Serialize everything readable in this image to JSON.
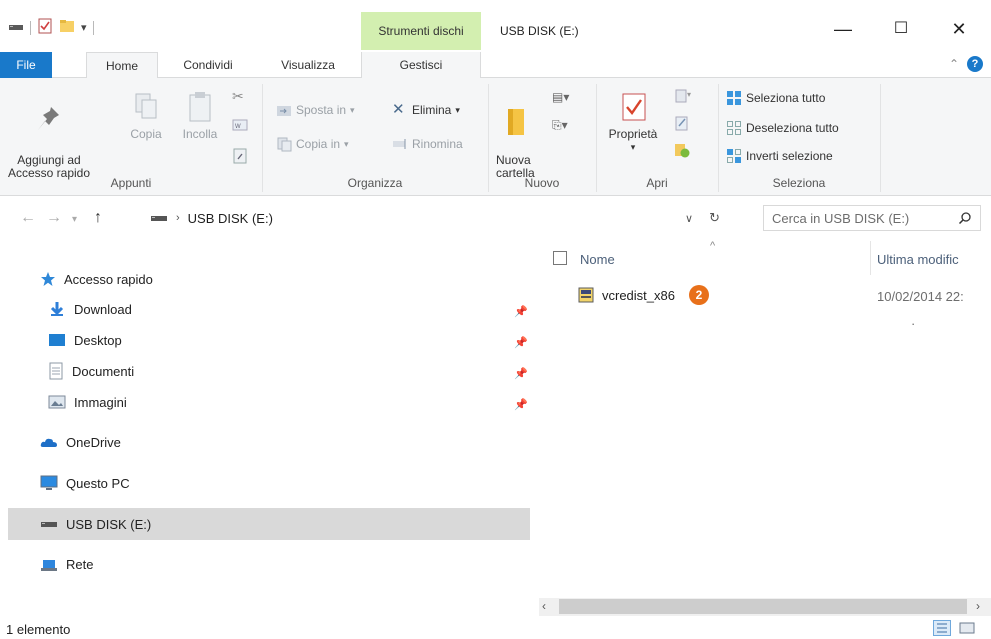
{
  "window": {
    "title": "USB DISK (E:)",
    "contextual_tab_group": "Strumenti dischi",
    "minimize_glyph": "—",
    "maximize_glyph": "☐",
    "close_glyph": "✕"
  },
  "tabs": {
    "file": "File",
    "home": "Home",
    "share": "Condividi",
    "view": "Visualizza",
    "manage": "Gestisci"
  },
  "ribbon": {
    "clipboard": {
      "label": "Appunti",
      "pin_quick_access": "Aggiungi ad\nAccesso rapido",
      "copy": "Copia",
      "paste": "Incolla"
    },
    "organize": {
      "label": "Organizza",
      "move_to": "Sposta in",
      "copy_to": "Copia in",
      "delete": "Elimina",
      "rename": "Rinomina"
    },
    "new": {
      "label": "Nuovo",
      "new_folder": "Nuova\ncartella"
    },
    "open": {
      "label": "Apri",
      "properties": "Proprietà"
    },
    "select": {
      "label": "Seleziona",
      "select_all": "Seleziona tutto",
      "select_none": "Deseleziona tutto",
      "invert": "Inverti selezione"
    }
  },
  "address": {
    "path_segment": "USB DISK (E:)",
    "search_placeholder": "Cerca in USB DISK (E:)"
  },
  "nav": {
    "quick_access": "Accesso rapido",
    "items": [
      {
        "label": "Download"
      },
      {
        "label": "Desktop"
      },
      {
        "label": "Documenti"
      },
      {
        "label": "Immagini"
      }
    ],
    "onedrive": "OneDrive",
    "this_pc": "Questo PC",
    "usb": "USB DISK (E:)",
    "network": "Rete"
  },
  "files": {
    "columns": {
      "name": "Nome",
      "modified": "Ultima modific"
    },
    "rows": [
      {
        "name": "vcredist_x86",
        "badge": "2",
        "modified": "10/02/2014 22:"
      }
    ],
    "stray_mark": "·"
  },
  "status": {
    "count": "1 elemento"
  },
  "colors": {
    "file_tab": "#1979ca",
    "context_tab": "#d3efb0",
    "badge": "#e8701a",
    "selection": "#d9d9d9"
  }
}
